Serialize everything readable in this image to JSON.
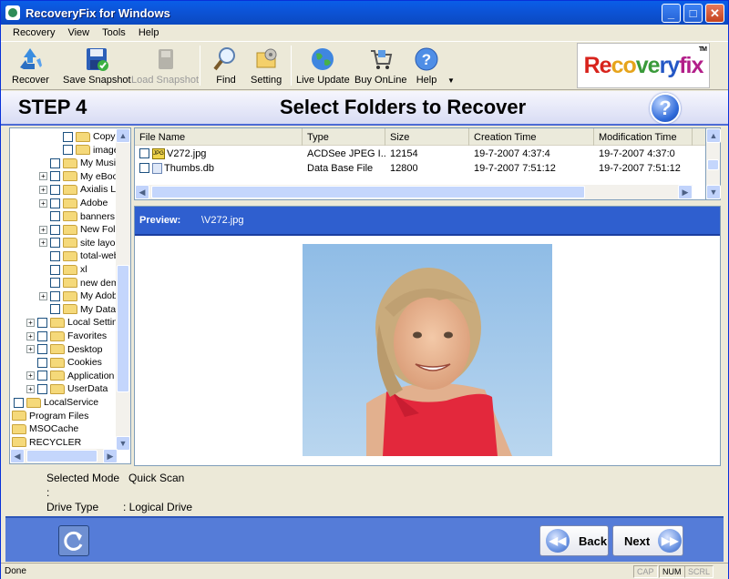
{
  "window": {
    "title": "RecoveryFix for Windows"
  },
  "menu": [
    "Recovery",
    "View",
    "Tools",
    "Help"
  ],
  "toolbar": {
    "recover": "Recover",
    "save_snapshot": "Save Snapshot",
    "load_snapshot": "Load Snapshot",
    "find": "Find",
    "setting": "Setting",
    "live_update": "Live Update",
    "buy_online": "Buy OnLine",
    "help": "Help"
  },
  "logo": {
    "text": "Recoveryfix",
    "tm": "TM"
  },
  "step": {
    "label": "STEP 4",
    "title": "Select Folders to Recover"
  },
  "tree": [
    {
      "label": "Copy o",
      "indent": 3,
      "pm": false
    },
    {
      "label": "images",
      "indent": 3,
      "pm": false
    },
    {
      "label": "My Music",
      "indent": 2,
      "pm": false
    },
    {
      "label": "My eBooks",
      "indent": 2,
      "pm": true
    },
    {
      "label": "Axialis Libr",
      "indent": 2,
      "pm": true
    },
    {
      "label": "Adobe",
      "indent": 2,
      "pm": true
    },
    {
      "label": "banners",
      "indent": 2,
      "pm": false
    },
    {
      "label": "New Folde",
      "indent": 2,
      "pm": true
    },
    {
      "label": "site layout",
      "indent": 2,
      "pm": true
    },
    {
      "label": "total-webs",
      "indent": 2,
      "pm": false
    },
    {
      "label": "xl",
      "indent": 2,
      "pm": false
    },
    {
      "label": "new demo",
      "indent": 2,
      "pm": false
    },
    {
      "label": "My Adobe",
      "indent": 2,
      "pm": true
    },
    {
      "label": "My Data S",
      "indent": 2,
      "pm": false
    },
    {
      "label": "Local Settings",
      "indent": 1,
      "pm": true
    },
    {
      "label": "Favorites",
      "indent": 1,
      "pm": true
    },
    {
      "label": "Desktop",
      "indent": 1,
      "pm": true
    },
    {
      "label": "Cookies",
      "indent": 1,
      "pm": false
    },
    {
      "label": "Application Da",
      "indent": 1,
      "pm": true
    },
    {
      "label": "UserData",
      "indent": 1,
      "pm": true
    },
    {
      "label": "LocalService",
      "indent": 0,
      "pm": false
    },
    {
      "label": "Program Files",
      "indent": -1,
      "pm": false
    },
    {
      "label": "MSOCache",
      "indent": -1,
      "pm": false
    },
    {
      "label": "RECYCLER",
      "indent": -1,
      "pm": false
    }
  ],
  "files": {
    "columns": [
      "File Name",
      "Type",
      "Size",
      "Creation Time",
      "Modification Time"
    ],
    "rows": [
      {
        "name": "V272.jpg",
        "type": "ACDSee JPEG I...",
        "size": "12154",
        "created": "19-7-2007 4:37:4",
        "modified": "19-7-2007 4:37:0"
      },
      {
        "name": "Thumbs.db",
        "type": "Data Base File",
        "size": "12800",
        "created": "19-7-2007 7:51:12",
        "modified": "19-7-2007 7:51:12"
      }
    ]
  },
  "preview": {
    "label": "Preview:",
    "file": "\\V272.jpg"
  },
  "info": {
    "mode_key": "Selected Mode :",
    "mode_val": "Quick Scan",
    "drive_key": "Drive Type",
    "drive_val": ": Logical Drive"
  },
  "nav": {
    "back": "Back",
    "next": "Next"
  },
  "status": {
    "text": "Done",
    "cap": "CAP",
    "num": "NUM",
    "scrl": "SCRL"
  }
}
